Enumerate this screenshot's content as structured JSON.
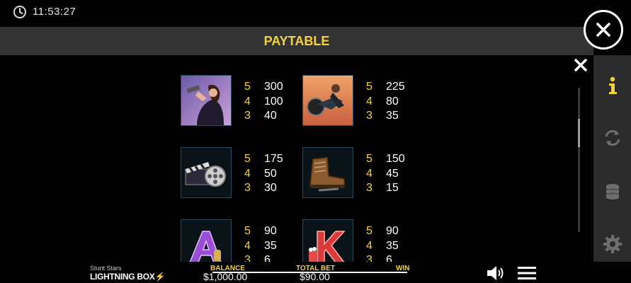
{
  "status_bar": {
    "time": "11:53:27",
    "clock_icon": "clock-icon"
  },
  "header": {
    "title": "PAYTABLE",
    "close_icon": "close-icon"
  },
  "sidebar": {
    "items": [
      {
        "name": "info",
        "icon": "info-icon",
        "active": true,
        "color": "#f4d23a"
      },
      {
        "name": "autoplay",
        "icon": "refresh-icon",
        "active": false
      },
      {
        "name": "bet",
        "icon": "coins-stack-icon",
        "active": false
      },
      {
        "name": "settings",
        "icon": "gear-icon",
        "active": false
      }
    ]
  },
  "paytable": {
    "symbols": [
      {
        "name": "woman-agent-symbol",
        "pays": [
          {
            "count": "5",
            "value": "300"
          },
          {
            "count": "4",
            "value": "100"
          },
          {
            "count": "3",
            "value": "40"
          }
        ]
      },
      {
        "name": "motorcycle-stunt-symbol",
        "pays": [
          {
            "count": "5",
            "value": "225"
          },
          {
            "count": "4",
            "value": "80"
          },
          {
            "count": "3",
            "value": "35"
          }
        ]
      },
      {
        "name": "film-reel-clapper-symbol",
        "pays": [
          {
            "count": "5",
            "value": "175"
          },
          {
            "count": "4",
            "value": "50"
          },
          {
            "count": "3",
            "value": "30"
          }
        ]
      },
      {
        "name": "boots-symbol",
        "pays": [
          {
            "count": "5",
            "value": "150"
          },
          {
            "count": "4",
            "value": "45"
          },
          {
            "count": "3",
            "value": "15"
          }
        ]
      },
      {
        "name": "letter-a-symbol",
        "pays": [
          {
            "count": "5",
            "value": "90"
          },
          {
            "count": "4",
            "value": "35"
          },
          {
            "count": "3",
            "value": "6"
          }
        ]
      },
      {
        "name": "letter-k-symbol",
        "pays": [
          {
            "count": "5",
            "value": "90"
          },
          {
            "count": "4",
            "value": "35"
          },
          {
            "count": "3",
            "value": "6"
          }
        ]
      }
    ]
  },
  "footer": {
    "game_name": "Stunt Stars",
    "brand": "LIGHTNING BOX",
    "balance_label": "BALANCE",
    "balance_value": "$1,000.00",
    "total_bet_label": "TOTAL BET",
    "total_bet_value": "$90.00",
    "win_label": "WIN",
    "sound_icon": "speaker-icon",
    "menu_icon": "hamburger-menu-icon"
  },
  "colors": {
    "accent": "#f4d23a",
    "header_bg": "#333333",
    "sidebar_bg": "#2b2b2b"
  }
}
